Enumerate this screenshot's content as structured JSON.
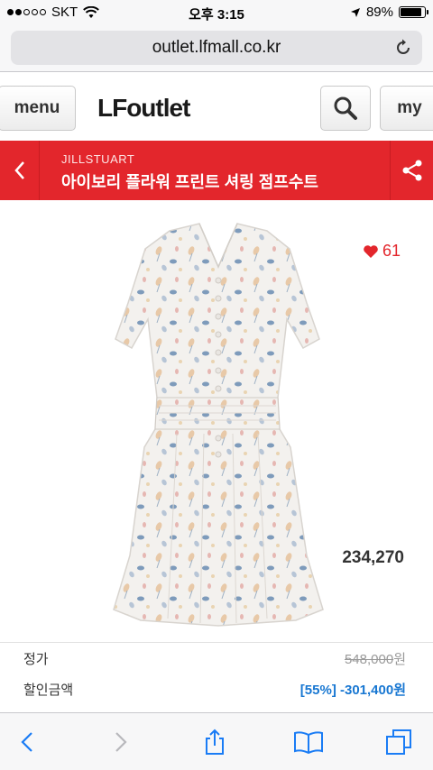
{
  "status": {
    "carrier": "SKT",
    "time": "오후 3:15",
    "battery_percent": "89%",
    "battery_level": 0.89,
    "signal_bars_filled": 2,
    "signal_bars_total": 5
  },
  "browser": {
    "url": "outlet.lfmall.co.kr"
  },
  "header": {
    "menu_label": "menu",
    "logo_text": "LFoutlet",
    "my_label": "my"
  },
  "product": {
    "brand": "JILLSTUART",
    "title": "아이보리 플라워 프린트 셔링 점프수트",
    "like_count": "61",
    "price": "234,270"
  },
  "pricing": {
    "original_label": "정가",
    "original_value": "548,000",
    "original_unit": "원",
    "discount_label": "할인금액",
    "discount_value": "[55%] -301,400원"
  },
  "colors": {
    "accent_red": "#e3262c",
    "discount_blue": "#1877d2"
  },
  "icons": {
    "search": "search-icon",
    "share": "share-icon",
    "back": "chevron-left-icon",
    "heart": "heart-icon",
    "reload": "reload-icon"
  }
}
